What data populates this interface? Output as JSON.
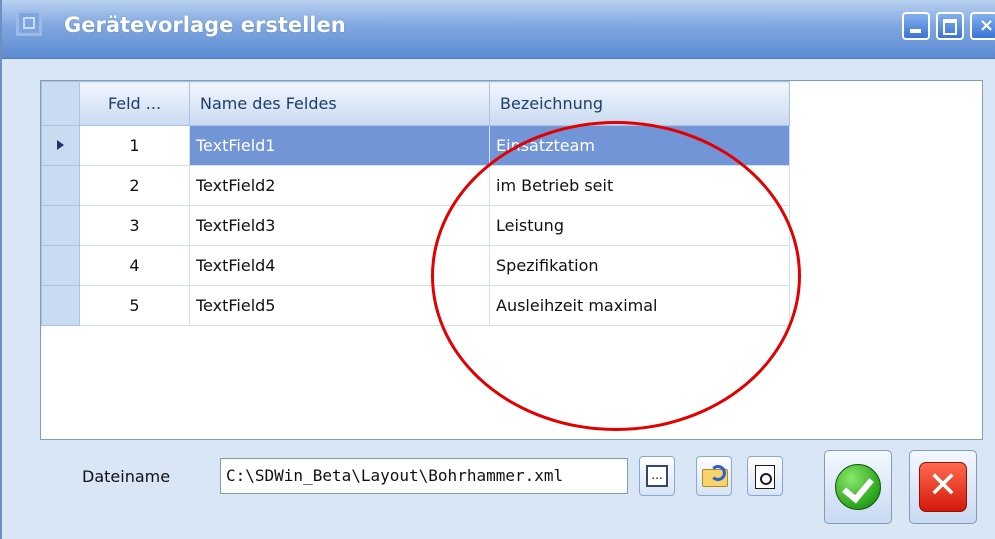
{
  "window": {
    "title": "Gerätevorlage erstellen",
    "close_glyph": "×"
  },
  "grid": {
    "columns": [
      "Feld ...",
      "Name des Feldes",
      "Bezeichnung"
    ],
    "rows": [
      {
        "feld": "1",
        "name": "TextField1",
        "bezeichnung": "Einsatzteam",
        "selected": true
      },
      {
        "feld": "2",
        "name": "TextField2",
        "bezeichnung": "im Betrieb seit",
        "selected": false
      },
      {
        "feld": "3",
        "name": "TextField3",
        "bezeichnung": "Leistung",
        "selected": false
      },
      {
        "feld": "4",
        "name": "TextField4",
        "bezeichnung": "Spezifikation",
        "selected": false
      },
      {
        "feld": "5",
        "name": "TextField5",
        "bezeichnung": "Ausleihzeit maximal",
        "selected": false
      }
    ]
  },
  "file": {
    "label": "Dateiname",
    "value": "C:\\SDWin_Beta\\Layout\\Bohrhammer.xml",
    "browse_glyph": "..."
  },
  "icons": {
    "browse": "browse-icon",
    "refresh": "refresh-icon",
    "preview": "preview-icon",
    "ok": "ok-icon",
    "cancel": "cancel-icon"
  },
  "buttons": {
    "cancel_glyph": "✕"
  },
  "colors": {
    "highlight": "#e20000",
    "selection": "#7295d7",
    "titlebar": "#5d8ad3"
  }
}
